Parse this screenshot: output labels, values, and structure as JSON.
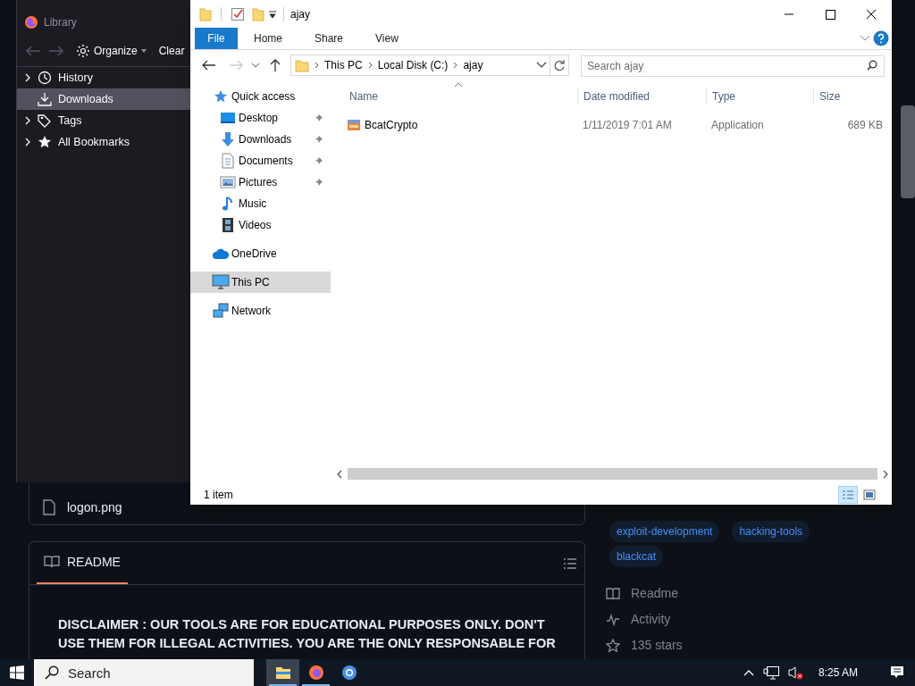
{
  "background_page": {
    "file_row": {
      "name": "logon.png"
    },
    "readme": {
      "tab": "README",
      "text": "DISCLAIMER : OUR TOOLS ARE FOR EDUCATIONAL PURPOSES ONLY. DON'T USE THEM FOR ILLEGAL ACTIVITIES. YOU ARE THE ONLY RESPONSABLE FOR"
    },
    "topics": [
      "exploit-development",
      "hacking-tools",
      "blackcat"
    ],
    "links": [
      {
        "kind": "readme",
        "label": "Readme"
      },
      {
        "kind": "activity",
        "label": "Activity"
      },
      {
        "kind": "stars",
        "label": "135 stars"
      }
    ]
  },
  "library_window": {
    "title": "Library",
    "organize": "Organize",
    "clear": "Clear",
    "tree": [
      {
        "kind": "history",
        "label": "History",
        "expandable": true,
        "selected": false
      },
      {
        "kind": "downloads",
        "label": "Downloads",
        "expandable": false,
        "selected": true
      },
      {
        "kind": "tags",
        "label": "Tags",
        "expandable": true,
        "selected": false
      },
      {
        "kind": "bookmarks",
        "label": "All Bookmarks",
        "expandable": true,
        "selected": false
      }
    ]
  },
  "explorer": {
    "title": "ajay",
    "ribbon_tabs": [
      {
        "kind": "file",
        "label": "File"
      },
      {
        "kind": "tab",
        "label": "Home"
      },
      {
        "kind": "tab",
        "label": "Share"
      },
      {
        "kind": "tab",
        "label": "View"
      }
    ],
    "address": [
      "This PC",
      "Local Disk (C:)",
      "ajay"
    ],
    "search": {
      "placeholder": "Search ajay"
    },
    "nav": [
      {
        "kind": "quick",
        "label": "Quick access",
        "selected": false,
        "children": [
          {
            "kind": "desktop",
            "label": "Desktop",
            "pinned": true,
            "selected": false
          },
          {
            "kind": "downloads",
            "label": "Downloads",
            "pinned": true,
            "selected": false
          },
          {
            "kind": "documents",
            "label": "Documents",
            "pinned": true,
            "selected": false
          },
          {
            "kind": "pictures",
            "label": "Pictures",
            "pinned": true,
            "selected": false
          },
          {
            "kind": "music",
            "label": "Music",
            "pinned": false,
            "selected": false
          },
          {
            "kind": "videos",
            "label": "Videos",
            "pinned": false,
            "selected": false
          }
        ]
      },
      {
        "kind": "onedrive",
        "label": "OneDrive",
        "selected": false
      },
      {
        "kind": "pc",
        "label": "This PC",
        "selected": true
      },
      {
        "kind": "network",
        "label": "Network",
        "selected": false
      }
    ],
    "columns": [
      "Name",
      "Date modified",
      "Type",
      "Size"
    ],
    "rows": [
      {
        "name": "BcatCrypto",
        "date": "1/11/2019 7:01 AM",
        "type": "Application",
        "size": "689 KB"
      }
    ],
    "status": "1 item",
    "views": [
      {
        "kind": "details",
        "selected": true
      },
      {
        "kind": "large",
        "selected": false
      }
    ]
  },
  "taskbar": {
    "search": {
      "placeholder": "Search"
    },
    "apps": [
      {
        "kind": "explorer",
        "active": true,
        "running": true
      },
      {
        "kind": "firefox",
        "active": false,
        "running": true
      },
      {
        "kind": "browser",
        "active": false,
        "running": false
      }
    ],
    "clock": "8:25 AM"
  }
}
